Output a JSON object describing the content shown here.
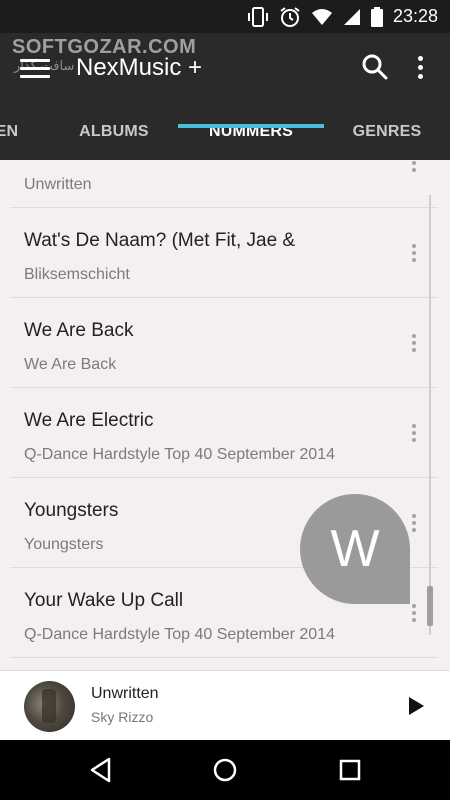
{
  "status_bar": {
    "time": "23:28",
    "icons": [
      "vibrate-icon",
      "alarm-icon",
      "wifi-icon",
      "signal-icon",
      "battery-icon"
    ]
  },
  "watermark": {
    "text": "SOFTGOZAR.COM",
    "subtext": "سافت گذار"
  },
  "app_bar": {
    "title": "NexMusic +",
    "tabs": [
      {
        "label": "EN"
      },
      {
        "label": "ALBUMS"
      },
      {
        "label": "NUMMERS"
      },
      {
        "label": "GENRES"
      }
    ],
    "active_tab": "NUMMERS",
    "accent_color": "#48c0da"
  },
  "songs": [
    {
      "title": "",
      "subtitle": "Unwritten"
    },
    {
      "title": "Wat's De Naam? (Met Fit, Jae &",
      "subtitle": "Bliksemschicht"
    },
    {
      "title": "We Are Back",
      "subtitle": "We Are Back"
    },
    {
      "title": "We Are Electric",
      "subtitle": "Q-Dance Hardstyle Top 40 September 2014"
    },
    {
      "title": "Youngsters",
      "subtitle": "Youngsters"
    },
    {
      "title": "Your Wake Up Call",
      "subtitle": "Q-Dance Hardstyle Top 40 September 2014"
    }
  ],
  "fast_scroll_letter": "W",
  "now_playing": {
    "title": "Unwritten",
    "artist": "Sky Rizzo"
  }
}
